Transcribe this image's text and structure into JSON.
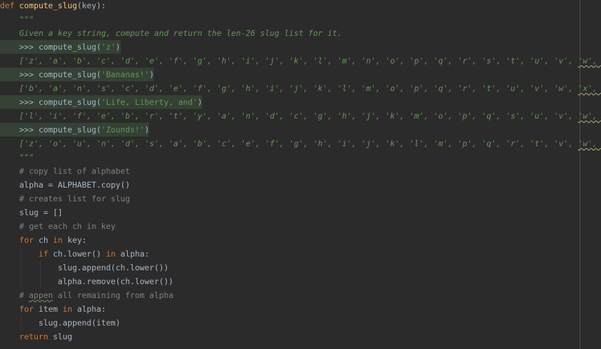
{
  "editor": {
    "lines": [
      {
        "indent": "",
        "parts": [
          {
            "t": "def ",
            "c": "kw"
          },
          {
            "t": "compute_slug",
            "c": "fn"
          },
          {
            "t": "(key):",
            "c": ""
          }
        ]
      },
      {
        "indent": "    ",
        "parts": [
          {
            "t": "\"\"\"",
            "c": "doc"
          }
        ]
      },
      {
        "indent": "    ",
        "parts": [
          {
            "t": "Given a key string, compute and return the len-26 slug list for it.",
            "c": "doc"
          }
        ]
      },
      {
        "indent": "    ",
        "hl": true,
        "parts": [
          {
            "t": ">>> compute_slug(",
            "c": "doctest"
          },
          {
            "t": "'z'",
            "c": "docstr"
          },
          {
            "t": ")",
            "c": "doctest"
          }
        ]
      },
      {
        "indent": "    ",
        "parts": [
          {
            "t": "['z', 'a', 'b', 'c', 'd', 'e', 'f', 'g', 'h', 'i', 'j', 'k', 'l', 'm', 'n', 'o', 'p', 'q', 'r', 's', 't', 'u', 'v', ",
            "c": "doc"
          },
          {
            "t": "'w', 'x', 'y']",
            "c": "doc warn"
          }
        ]
      },
      {
        "indent": "    ",
        "hl": true,
        "parts": [
          {
            "t": ">>> compute_slug(",
            "c": "doctest"
          },
          {
            "t": "'Bananas!'",
            "c": "docstr"
          },
          {
            "t": ")",
            "c": "doctest"
          }
        ]
      },
      {
        "indent": "    ",
        "parts": [
          {
            "t": "['b', 'a', 'n', 's', 'c', 'd', 'e', 'f', 'g', 'h', 'i', 'j', 'k', 'l', 'm', 'o', 'p', 'q', 'r', 't', 'u', 'v', 'w', ",
            "c": "doc"
          },
          {
            "t": "'x', 'y', 'z']",
            "c": "doc warn"
          }
        ]
      },
      {
        "indent": "    ",
        "hl": true,
        "parts": [
          {
            "t": ">>> compute_slug(",
            "c": "doctest"
          },
          {
            "t": "'Life, Liberty, and'",
            "c": "docstr"
          },
          {
            "t": ")",
            "c": "doctest"
          }
        ]
      },
      {
        "indent": "    ",
        "parts": [
          {
            "t": "['l', 'i', 'f', 'e', 'b', 'r', 't', 'y', 'a', 'n', 'd', 'c', 'g', 'h', 'j', 'k', 'm', 'o', 'p', 'q', 's', 'u', 'v', ",
            "c": "doc"
          },
          {
            "t": "'w', 'x', 'z']",
            "c": "doc warn"
          }
        ]
      },
      {
        "indent": "    ",
        "hl": true,
        "parts": [
          {
            "t": ">>> compute_slug(",
            "c": "doctest"
          },
          {
            "t": "'Zounds!'",
            "c": "docstr"
          },
          {
            "t": ")",
            "c": "doctest"
          }
        ]
      },
      {
        "indent": "    ",
        "parts": [
          {
            "t": "['z', 'o', 'u', 'n', 'd', 's', 'a', 'b', 'c', 'e', 'f', 'g', 'h', 'i', 'j', 'k', 'l', 'm', 'p', 'q', 'r', 't', 'v', ",
            "c": "doc"
          },
          {
            "t": "'w', 'x', 'y']",
            "c": "doc warn"
          }
        ]
      },
      {
        "indent": "    ",
        "parts": [
          {
            "t": "\"\"\"",
            "c": "doc"
          }
        ]
      },
      {
        "indent": "    ",
        "parts": [
          {
            "t": "# copy list of alphabet",
            "c": "cm"
          }
        ]
      },
      {
        "indent": "    ",
        "parts": [
          {
            "t": "alpha = ALPHABET.copy()",
            "c": ""
          }
        ]
      },
      {
        "indent": "    ",
        "parts": [
          {
            "t": "# creates list for slug",
            "c": "cm"
          }
        ]
      },
      {
        "indent": "    ",
        "parts": [
          {
            "t": "slug = []",
            "c": ""
          }
        ]
      },
      {
        "indent": "    ",
        "parts": [
          {
            "t": "# get each ch in key",
            "c": "cm"
          }
        ]
      },
      {
        "indent": "    ",
        "parts": [
          {
            "t": "for",
            "c": "kw"
          },
          {
            "t": " ch ",
            "c": ""
          },
          {
            "t": "in",
            "c": "kw"
          },
          {
            "t": " key:",
            "c": ""
          }
        ]
      },
      {
        "indent": "        ",
        "parts": [
          {
            "t": "if",
            "c": "kw"
          },
          {
            "t": " ch.lower() ",
            "c": ""
          },
          {
            "t": "in",
            "c": "kw"
          },
          {
            "t": " alpha:",
            "c": ""
          }
        ]
      },
      {
        "indent": "            ",
        "parts": [
          {
            "t": "slug.append(ch.lower())",
            "c": ""
          }
        ]
      },
      {
        "indent": "            ",
        "parts": [
          {
            "t": "alpha.remove(ch.lower())",
            "c": ""
          }
        ]
      },
      {
        "indent": "    ",
        "parts": [
          {
            "t": "# ",
            "c": "cm"
          },
          {
            "t": "appen",
            "c": "cm typo"
          },
          {
            "t": " all remaining from alpha",
            "c": "cm"
          }
        ]
      },
      {
        "indent": "    ",
        "parts": [
          {
            "t": "for",
            "c": "kw"
          },
          {
            "t": " item ",
            "c": ""
          },
          {
            "t": "in",
            "c": "kw"
          },
          {
            "t": " alpha:",
            "c": ""
          }
        ]
      },
      {
        "indent": "        ",
        "parts": [
          {
            "t": "slug.append(item)",
            "c": ""
          }
        ]
      },
      {
        "indent": "    ",
        "parts": [
          {
            "t": "return",
            "c": "kw"
          },
          {
            "t": " slug",
            "c": ""
          }
        ]
      }
    ]
  },
  "colors": {
    "background": "#2b2b2b",
    "keyword": "#cc7832",
    "function": "#ffc66d",
    "docstring": "#629755",
    "comment": "#808080",
    "text": "#a9b7c6",
    "doctest_highlight": "#344134"
  }
}
